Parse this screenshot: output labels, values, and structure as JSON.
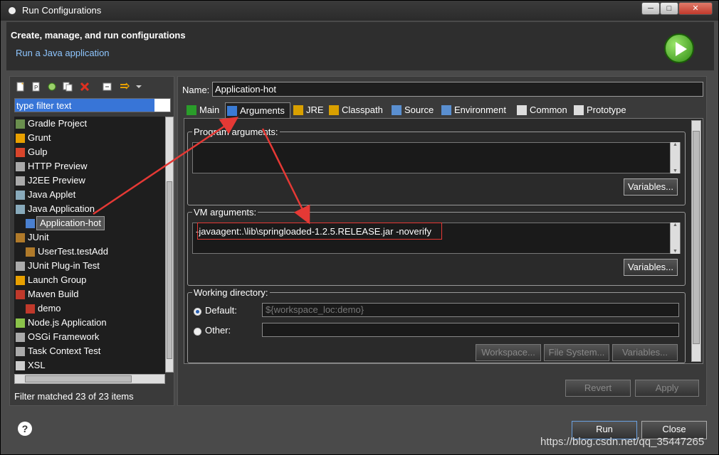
{
  "window": {
    "title": "Run Configurations"
  },
  "header": {
    "title": "Create, manage, and run configurations",
    "subtitle": "Run a Java application"
  },
  "filter": {
    "value": "type filter text"
  },
  "tree": [
    {
      "label": "Gradle Project",
      "indent": 0,
      "icon": "gradle-icon"
    },
    {
      "label": "Grunt",
      "indent": 0,
      "icon": "grunt-icon"
    },
    {
      "label": "Gulp",
      "indent": 0,
      "icon": "gulp-icon"
    },
    {
      "label": "HTTP Preview",
      "indent": 0,
      "icon": "http-preview-icon"
    },
    {
      "label": "J2EE Preview",
      "indent": 0,
      "icon": "j2ee-preview-icon"
    },
    {
      "label": "Java Applet",
      "indent": 0,
      "icon": "java-applet-icon"
    },
    {
      "label": "Java Application",
      "indent": 0,
      "icon": "java-application-icon"
    },
    {
      "label": "Application-hot",
      "indent": 1,
      "icon": "java-class-icon",
      "selected": true
    },
    {
      "label": "JUnit",
      "indent": 0,
      "icon": "junit-icon"
    },
    {
      "label": "UserTest.testAdd",
      "indent": 1,
      "icon": "junit-icon"
    },
    {
      "label": "JUnit Plug-in Test",
      "indent": 0,
      "icon": "junit-plugin-icon"
    },
    {
      "label": "Launch Group",
      "indent": 0,
      "icon": "launch-group-icon"
    },
    {
      "label": "Maven Build",
      "indent": 0,
      "icon": "maven-icon"
    },
    {
      "label": "demo",
      "indent": 1,
      "icon": "maven-icon"
    },
    {
      "label": "Node.js Application",
      "indent": 0,
      "icon": "nodejs-icon"
    },
    {
      "label": "OSGi Framework",
      "indent": 0,
      "icon": "osgi-icon"
    },
    {
      "label": "Task Context Test",
      "indent": 0,
      "icon": "task-context-icon"
    },
    {
      "label": "XSL",
      "indent": 0,
      "icon": "xsl-icon"
    }
  ],
  "filter_status": "Filter matched 23 of 23 items",
  "config": {
    "name_label": "Name:",
    "name_value": "Application-hot",
    "tabs": [
      {
        "label": "Main",
        "icon": "main-tab-icon"
      },
      {
        "label": "Arguments",
        "icon": "arguments-tab-icon",
        "active": true
      },
      {
        "label": "JRE",
        "icon": "jre-tab-icon"
      },
      {
        "label": "Classpath",
        "icon": "classpath-tab-icon"
      },
      {
        "label": "Source",
        "icon": "source-tab-icon"
      },
      {
        "label": "Environment",
        "icon": "environment-tab-icon"
      },
      {
        "label": "Common",
        "icon": "common-tab-icon"
      },
      {
        "label": "Prototype",
        "icon": "prototype-tab-icon"
      }
    ],
    "program_args_label": "Program arguments:",
    "program_args_value": "",
    "variables_label": "Variables...",
    "vm_args_label": "VM arguments:",
    "vm_args_value": "-javaagent:.\\lib\\springloaded-1.2.5.RELEASE.jar -noverify",
    "working_dir_label": "Working directory:",
    "default_label": "Default:",
    "default_value": "${workspace_loc:demo}",
    "other_label": "Other:",
    "other_value": "",
    "workspace_label": "Workspace...",
    "filesystem_label": "File System...",
    "revert_label": "Revert",
    "apply_label": "Apply"
  },
  "footer": {
    "run_label": "Run",
    "close_label": "Close"
  },
  "watermark": "https://blog.csdn.net/qq_35447265",
  "colors": {
    "annotation": "#e53935",
    "selection": "#3875d7"
  }
}
